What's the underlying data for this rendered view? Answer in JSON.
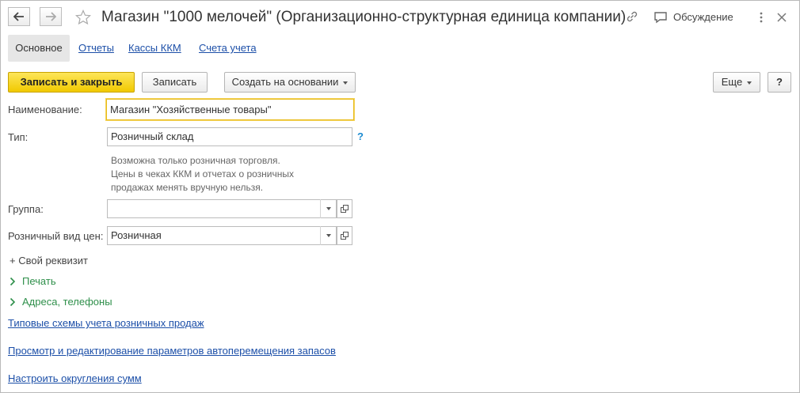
{
  "window": {
    "title": "Магазин \"1000 мелочей\" (Организационно-структурная единица компании)",
    "discussion_label": "Обсуждение"
  },
  "tabs": [
    {
      "label": "Основное",
      "active": true
    },
    {
      "label": "Отчеты",
      "active": false
    },
    {
      "label": "Кассы ККМ",
      "active": false
    },
    {
      "label": "Счета учета",
      "active": false
    }
  ],
  "toolbar": {
    "save_close_label": "Записать и закрыть",
    "save_label": "Записать",
    "create_based_label": "Создать на основании",
    "more_label": "Еще",
    "help_label": "?"
  },
  "form": {
    "name_label": "Наименование:",
    "name_value": "Магазин \"Хозяйственные товары\"",
    "type_label": "Тип:",
    "type_value": "Розничный склад",
    "type_help": "?",
    "hint_lines": [
      "Возможна только розничная торговля.",
      "Цены в чеках ККМ и отчетах о розничных",
      "продажах менять вручную нельзя."
    ],
    "group_label": "Группа:",
    "group_value": "",
    "price_type_label": "Розничный вид цен:",
    "price_type_value": "Розничная",
    "custom_attr_label": "+ Свой реквизит"
  },
  "groups": {
    "print_label": "Печать",
    "addresses_label": "Адреса, телефоны"
  },
  "links": {
    "schemes": "Типовые схемы учета розничных продаж",
    "auto_move": "Просмотр и редактирование параметров автоперемещения запасов",
    "rounding": "Настроить округления сумм"
  },
  "colors": {
    "accent_yellow": "#f1c900",
    "link_blue": "#1c4fa8",
    "group_green": "#2e8f4a",
    "help_blue": "#1b8bd0"
  }
}
